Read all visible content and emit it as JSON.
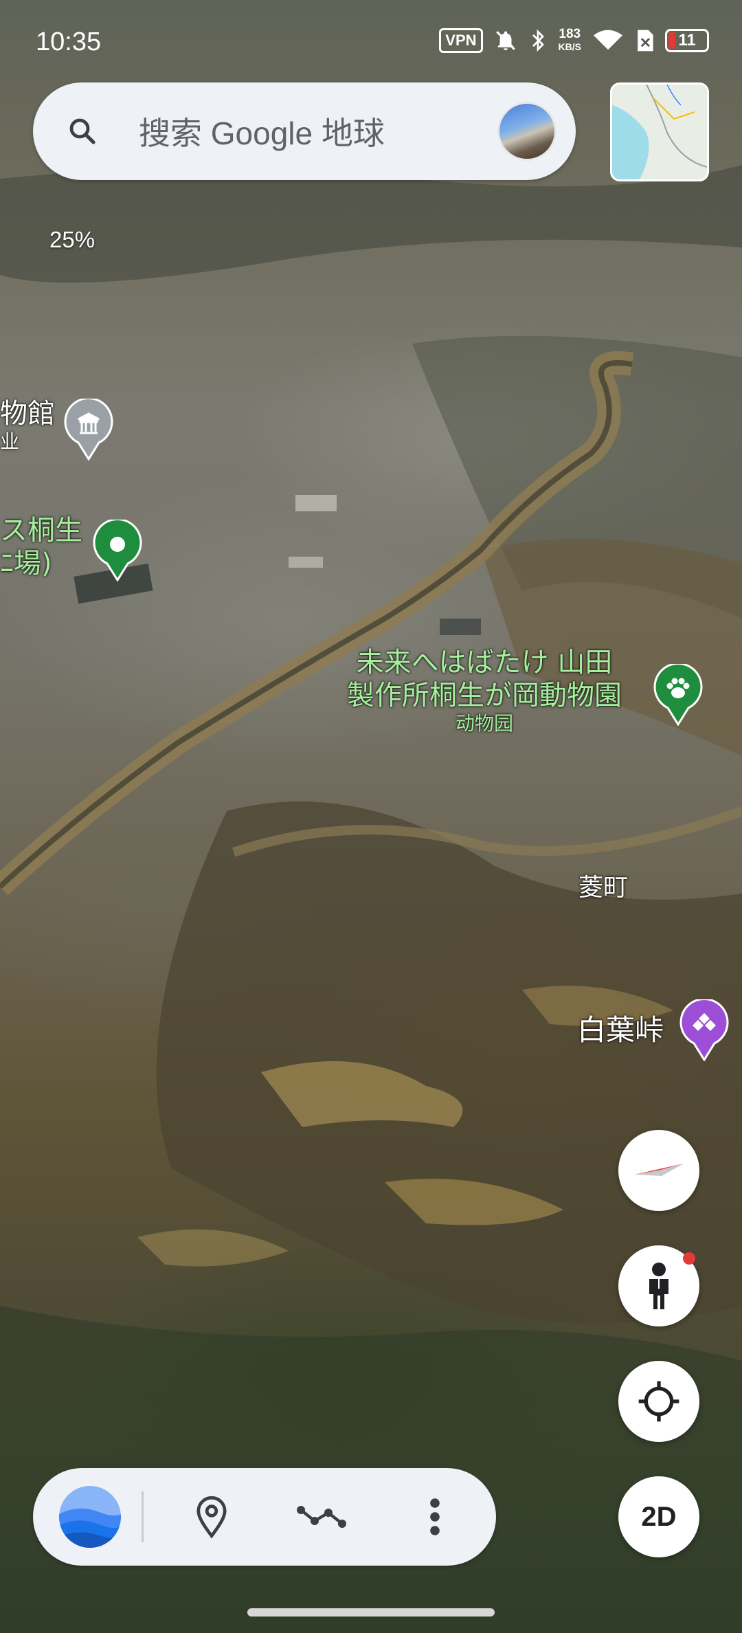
{
  "status_bar": {
    "time": "10:35",
    "vpn": "VPN",
    "speed_value": "183",
    "speed_unit": "KB/S",
    "battery": "11"
  },
  "search": {
    "placeholder": "搜索 Google 地球",
    "icon": "search-icon"
  },
  "overlay": {
    "zoom": "25%"
  },
  "map_labels": {
    "museum_title": "物館",
    "museum_sub": "业",
    "place_line1": "ス桐生",
    "place_line2": "ﾆ場)",
    "zoo_line1": "未来へはばたけ 山田",
    "zoo_line2": "製作所桐生が岡動物園",
    "zoo_category": "动物园",
    "hishi": "菱町",
    "shirahato": "白葉峠"
  },
  "controls": {
    "view_mode": "2D",
    "compass": "compass-icon",
    "street_view": "pegman-icon",
    "locate": "my-location-icon"
  },
  "toolbar": {
    "items": [
      "earth-logo-icon",
      "place-pin-icon",
      "measure-path-icon",
      "more-vert-icon"
    ]
  },
  "colors": {
    "accent_blue": "#1a73e8",
    "label_green": "#a5ef9c",
    "poi_green": "#1e8e3e",
    "poi_gray": "#9aa0a6",
    "poi_purple": "#9c4fd6",
    "panel_bg": "#eef2f7"
  }
}
